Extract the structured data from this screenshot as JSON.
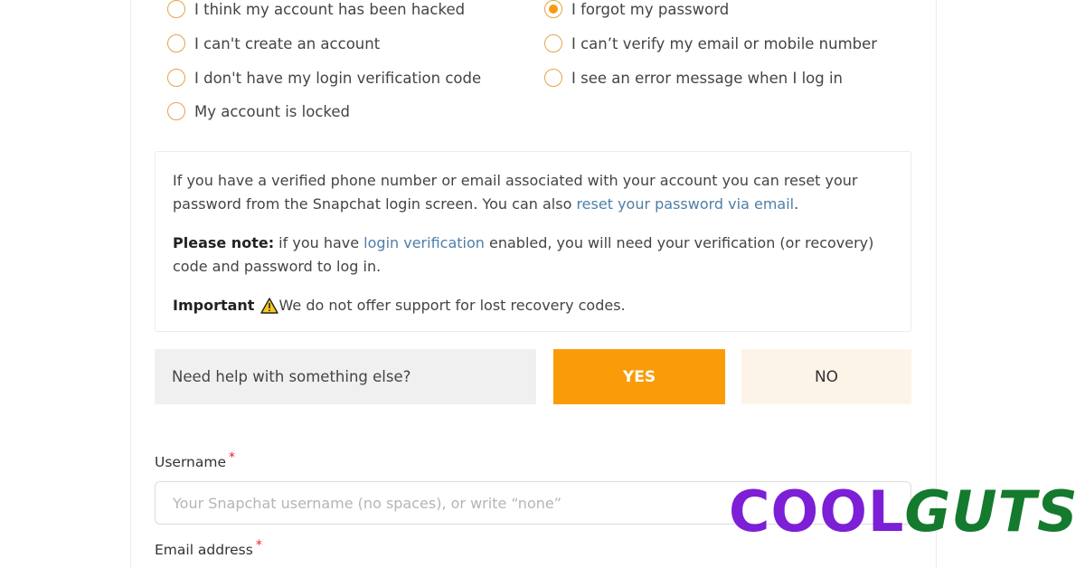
{
  "issue_options": [
    {
      "label": "I think my account has been hacked",
      "checked": false
    },
    {
      "label": "I forgot my password",
      "checked": true
    },
    {
      "label": "I can't create an account",
      "checked": false
    },
    {
      "label": "I can’t verify my email or mobile number",
      "checked": false
    },
    {
      "label": "I don't have my login verification code",
      "checked": false
    },
    {
      "label": "I see an error message when I log in",
      "checked": false
    },
    {
      "label": "My account is locked",
      "checked": false
    }
  ],
  "info": {
    "p1_text": "If you have a verified phone number or email associated with your account you can reset your password from the Snapchat login screen. You can also ",
    "p1_link": "reset your password via email",
    "p1_end": ".",
    "p2_bold": "Please note:",
    "p2_text1": " if you have ",
    "p2_link": "login verification",
    "p2_text2": " enabled, you will need your verification (or recovery) code and password to log in.",
    "p3_bold": "Important",
    "p3_text": "We do not offer support for lost recovery codes.",
    "link_color": "#4d7fa8"
  },
  "help_prompt": {
    "question": "Need help with something else?",
    "yes_label": "YES",
    "no_label": "NO",
    "accent_color": "#fa9c0a"
  },
  "form": {
    "username_label": "Username",
    "username_placeholder": "Your Snapchat username (no spaces), or write “none”",
    "username_value": "",
    "email_label": "Email address",
    "required_mark": "*"
  },
  "watermark": {
    "part1": "COOL",
    "part2": "GUTS"
  }
}
